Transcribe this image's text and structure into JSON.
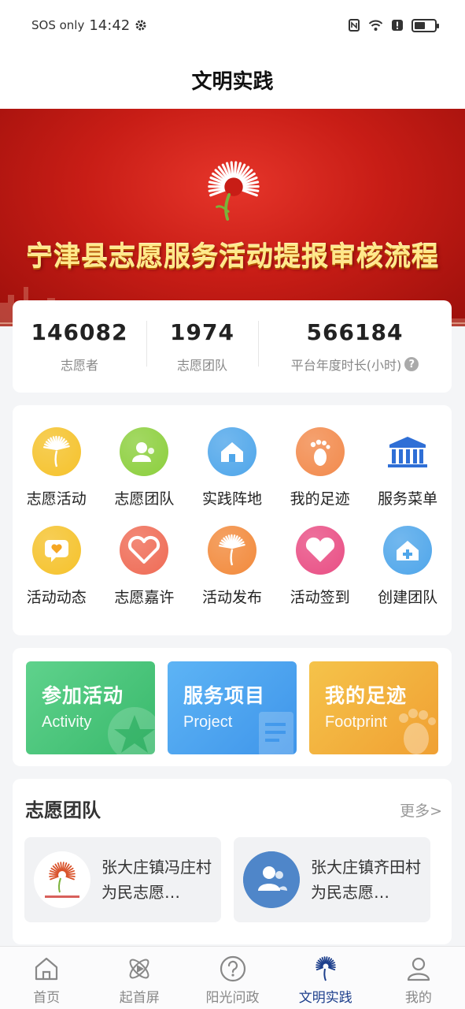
{
  "status_bar": {
    "carrier": "SOS only",
    "time": "14:42",
    "battery_level": 0.55
  },
  "header": {
    "title": "文明实践"
  },
  "banner": {
    "title": "宁津县志愿服务活动提报审核流程"
  },
  "stats": [
    {
      "value": "146082",
      "label": "志愿者"
    },
    {
      "value": "1974",
      "label": "志愿团队"
    },
    {
      "value": "566184",
      "label": "平台年度时长(小时)"
    }
  ],
  "grid": [
    {
      "label": "志愿活动",
      "icon": "fan-icon",
      "color": "#f5c22b"
    },
    {
      "label": "志愿团队",
      "icon": "team-icon",
      "color": "#8ccf3d"
    },
    {
      "label": "实践阵地",
      "icon": "home-icon",
      "color": "#4fa6ea"
    },
    {
      "label": "我的足迹",
      "icon": "footprint-icon",
      "color": "#f28a4c"
    },
    {
      "label": "服务菜单",
      "icon": "bank-icon",
      "color": "#2f6fd6"
    },
    {
      "label": "活动动态",
      "icon": "chat-heart-icon",
      "color": "#f5c22b"
    },
    {
      "label": "志愿嘉许",
      "icon": "heart-hands-icon",
      "color": "#ef6b55"
    },
    {
      "label": "活动发布",
      "icon": "fan-icon",
      "color": "#f28a3c"
    },
    {
      "label": "活动签到",
      "icon": "heart-icon",
      "color": "#e94e84"
    },
    {
      "label": "创建团队",
      "icon": "home-plus-icon",
      "color": "#4fa6ea"
    }
  ],
  "quick": [
    {
      "title": "参加活动",
      "subtitle": "Activity",
      "color_from": "#5fd28c",
      "color_to": "#39b96c"
    },
    {
      "title": "服务项目",
      "subtitle": "Project",
      "color_from": "#5db4f5",
      "color_to": "#3f95ea"
    },
    {
      "title": "我的足迹",
      "subtitle": "Footprint",
      "color_from": "#f5c34a",
      "color_to": "#f0a033"
    }
  ],
  "team_section": {
    "title": "志愿团队",
    "more": "更多>",
    "items": [
      {
        "name": "张大庄镇冯庄村为民志愿…"
      },
      {
        "name": "张大庄镇齐田村为民志愿…"
      }
    ]
  },
  "bottom_nav": [
    {
      "label": "首页",
      "icon": "home-outline-icon",
      "active": false
    },
    {
      "label": "起首屏",
      "icon": "atom-icon",
      "active": false
    },
    {
      "label": "阳光问政",
      "icon": "question-icon",
      "active": false
    },
    {
      "label": "文明实践",
      "icon": "fan-logo-icon",
      "active": true
    },
    {
      "label": "我的",
      "icon": "user-icon",
      "active": false
    }
  ]
}
